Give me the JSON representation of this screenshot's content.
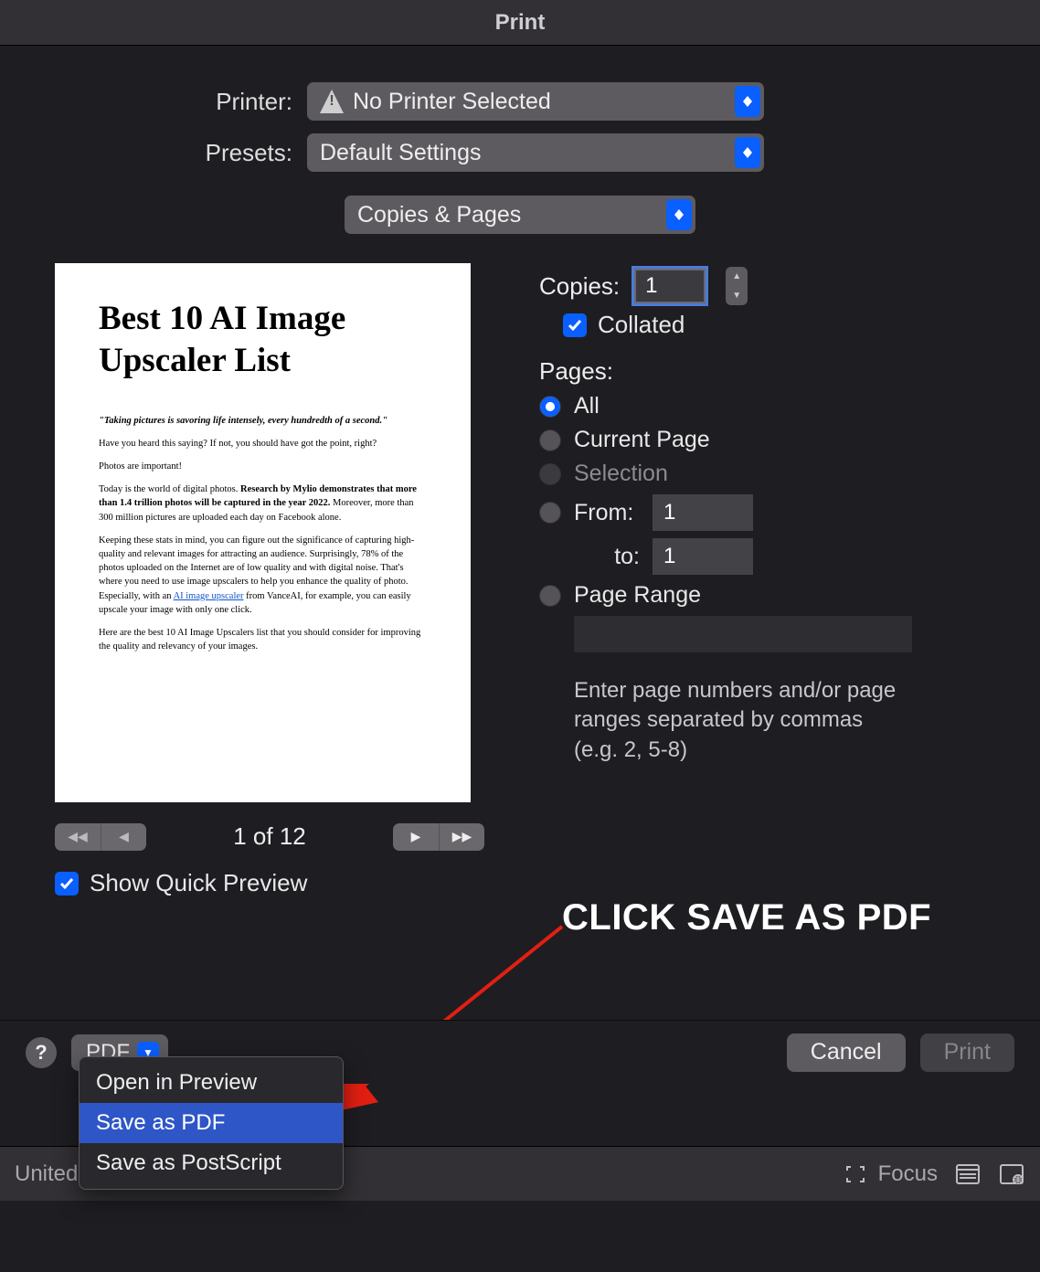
{
  "title": "Print",
  "form": {
    "printer_label": "Printer:",
    "printer_value": "No Printer Selected",
    "presets_label": "Presets:",
    "presets_value": "Default Settings",
    "section_value": "Copies & Pages",
    "copies_label": "Copies:",
    "copies_value": "1",
    "collated_label": "Collated",
    "pages_label": "Pages:",
    "pages_all": "All",
    "pages_current": "Current Page",
    "pages_selection": "Selection",
    "pages_from_label": "From:",
    "pages_from_value": "1",
    "pages_to_label": "to:",
    "pages_to_value": "1",
    "pages_range_label": "Page Range",
    "pages_help": "Enter page numbers and/or page ranges separated by commas (e.g. 2, 5-8)"
  },
  "preview": {
    "heading": "Best 10 AI Image Upscaler List",
    "quote": "\"Taking pictures is savoring life intensely, every hundredth of a second.\"",
    "p1": "Have you heard this saying? If not, you should have got the point, right?",
    "p2": "Photos are important!",
    "p3a": "Today is the world of digital photos. ",
    "p3b": "Research by Mylio demonstrates that more than 1.4 trillion photos will be captured in the year 2022.",
    "p3c": " Moreover, more than 300 million pictures are uploaded each day on Facebook alone.",
    "p4a": "Keeping these stats in mind, you can figure out the significance of capturing high-quality and relevant images for attracting an audience. Surprisingly, 78% of the photos uploaded on the Internet are of low quality and with digital noise. That's where you need to use image upscalers to help you enhance the quality of photo. Especially, with an ",
    "p4link": "AI image upscaler",
    "p4b": " from VanceAI, for example, you can easily upscale your image with only one click.",
    "p5": "Here are the best 10 AI Image Upscalers list that you should consider for improving the quality and relevancy of your images."
  },
  "pager": {
    "label": "1 of 12",
    "show_quick_preview": "Show Quick Preview"
  },
  "footer": {
    "pdf": "PDF",
    "cancel": "Cancel",
    "print": "Print"
  },
  "menu": {
    "open_preview": "Open in Preview",
    "save_pdf": "Save as PDF",
    "save_ps": "Save as PostScript"
  },
  "annotation": "CLICK SAVE AS PDF",
  "statusbar": {
    "left": "United",
    "focus": "Focus"
  }
}
